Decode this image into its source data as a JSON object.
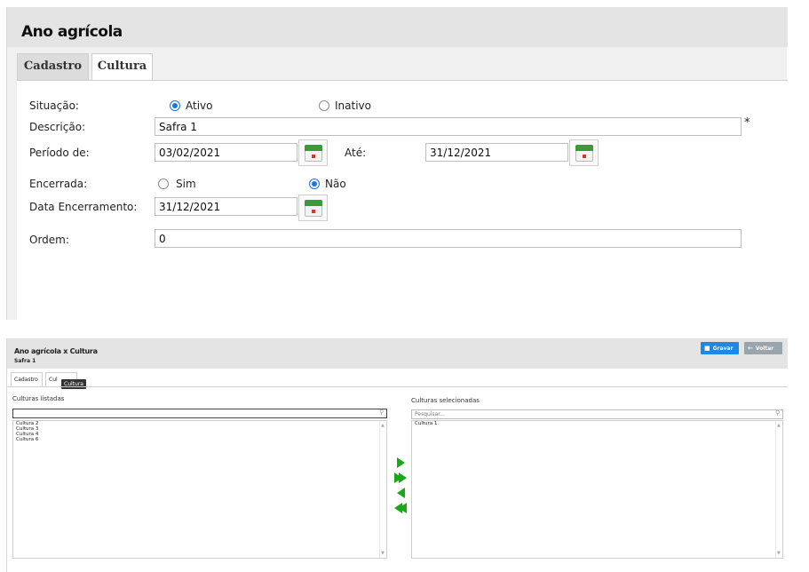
{
  "panel1": {
    "title": "Ano agrícola",
    "tabs": [
      {
        "label": "Cadastro"
      },
      {
        "label": "Cultura"
      }
    ],
    "fields": {
      "situacao": {
        "label": "Situação:",
        "options": [
          "Ativo",
          "Inativo"
        ],
        "selected": "Ativo"
      },
      "descricao": {
        "label": "Descrição:",
        "value": "Safra 1",
        "required": "*"
      },
      "periodo": {
        "label": "Período de:",
        "from": "03/02/2021",
        "to_label": "Até:",
        "to": "31/12/2021"
      },
      "encerrada": {
        "label": "Encerrada:",
        "options": [
          "Sim",
          "Não"
        ],
        "selected": "Não"
      },
      "data_encerramento": {
        "label": "Data Encerramento:",
        "value": "31/12/2021"
      },
      "ordem": {
        "label": "Ordem:",
        "value": "0"
      }
    }
  },
  "panel2": {
    "title": "Ano agrícola x Cultura",
    "subtitle": "Safra 1",
    "buttons": {
      "save": "Gravar",
      "back": "Voltar"
    },
    "tabs": [
      {
        "label": "Cadastro"
      },
      {
        "label": "Cul"
      }
    ],
    "tooltip": "Cultura",
    "left": {
      "label": "Culturas listadas",
      "search_value": "",
      "items": [
        "Cultura 2",
        "Cultura 3",
        "Cultura 4",
        "Cultura 6"
      ]
    },
    "right": {
      "label": "Culturas selecionadas",
      "search_placeholder": "Pesquisar...",
      "items": [
        "Cultura 1"
      ]
    }
  },
  "icons": {
    "calendar": "calendar-icon",
    "search": "magnifier-icon",
    "save": "floppy-icon",
    "back": "arrow-left-icon",
    "move_right": "arrow-right-icon",
    "move_all_right": "double-arrow-right-icon",
    "move_left": "arrow-left-icon",
    "move_all_left": "double-arrow-left-icon"
  },
  "colors": {
    "accent": "#1a73e8",
    "transfer_arrows": "#18a818",
    "save_button": "#1e88e5"
  }
}
